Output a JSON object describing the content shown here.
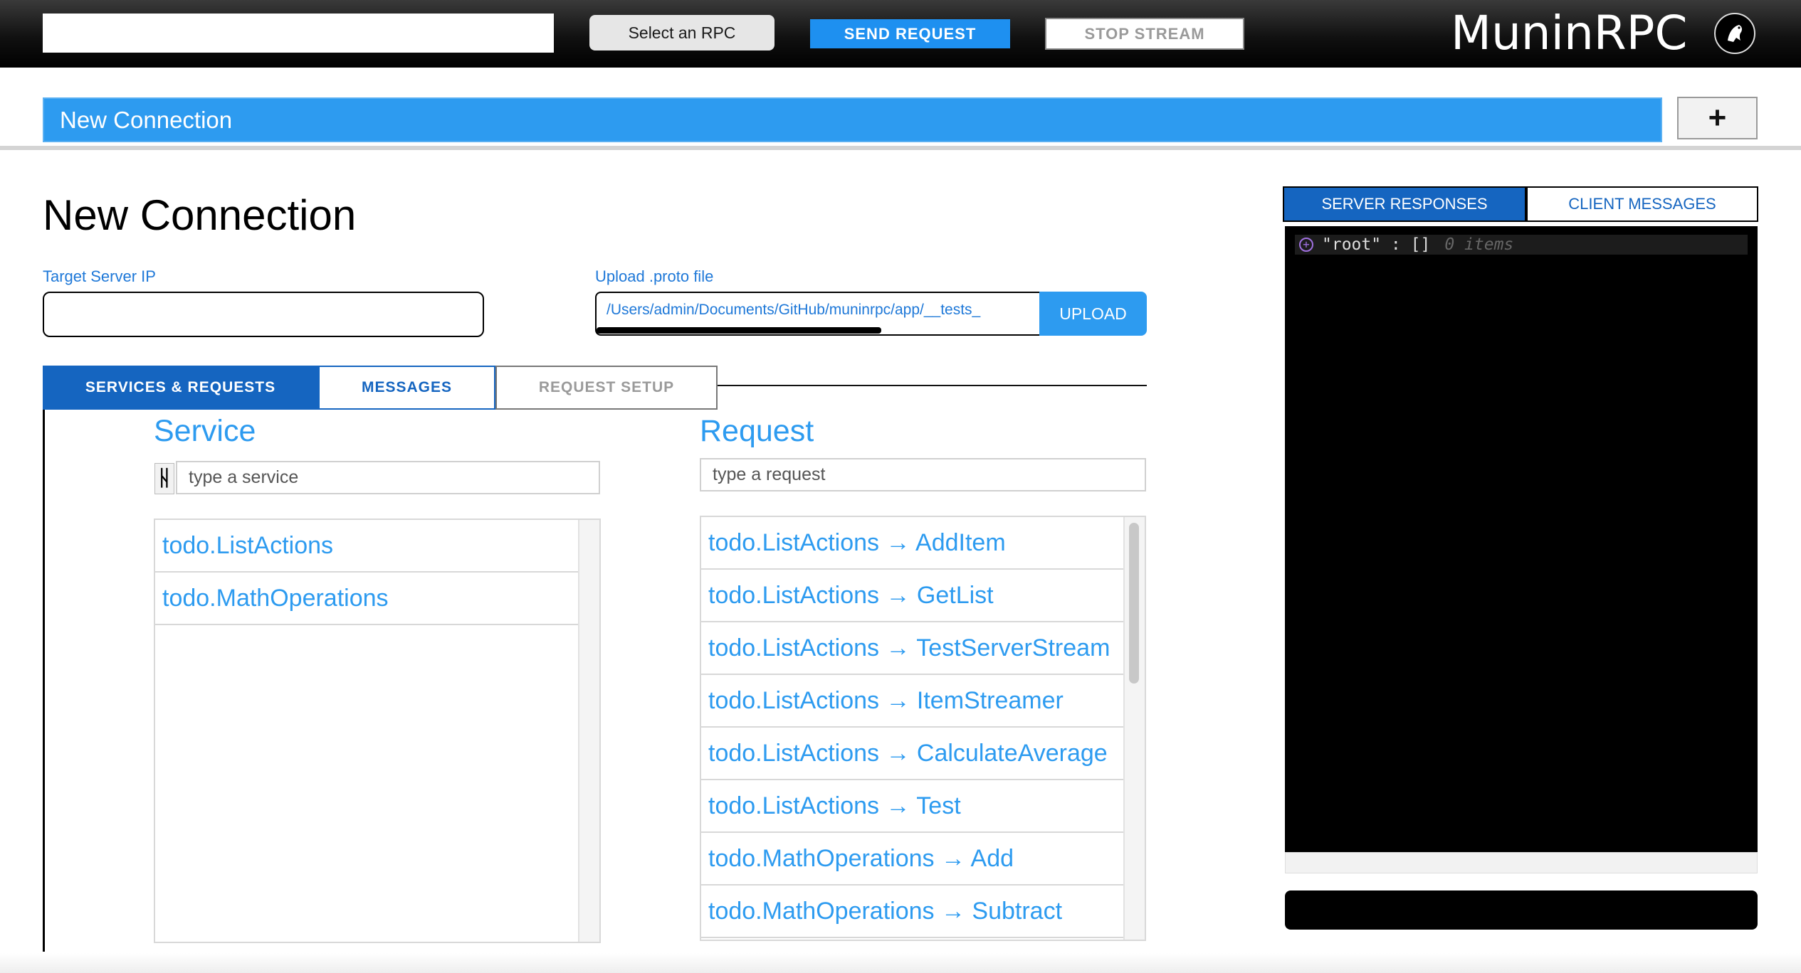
{
  "topbar": {
    "address_value": "",
    "select_rpc_label": "Select an RPC",
    "send_label": "SEND REQUEST",
    "stop_label": "STOP STREAM",
    "brand": "MuninRPC",
    "logo_icon": "raven-logo-icon"
  },
  "connection_tab": {
    "label": "New Connection",
    "add_label": "+"
  },
  "main": {
    "title": "New Connection",
    "target_label": "Target Server IP",
    "target_value": "",
    "upload_label": "Upload .proto file",
    "file_path": "/Users/admin/Documents/GitHub/muninrpc/app/__tests_",
    "upload_button": "UPLOAD"
  },
  "tabs": {
    "services": "SERVICES & REQUESTS",
    "messages": "MESSAGES",
    "setup": "REQUEST SETUP"
  },
  "service": {
    "title": "Service",
    "placeholder": "type a service",
    "filter_glyph": "ᚺ",
    "items": [
      "todo.ListActions",
      "todo.MathOperations"
    ]
  },
  "request": {
    "title": "Request",
    "placeholder": "type a request",
    "items": [
      "todo.ListActions → AddItem",
      "todo.ListActions → GetList",
      "todo.ListActions → TestServerStream",
      "todo.ListActions → ItemStreamer",
      "todo.ListActions → CalculateAverage",
      "todo.ListActions → Test",
      "todo.MathOperations → Add",
      "todo.MathOperations → Subtract"
    ]
  },
  "responses": {
    "server_tab": "SERVER RESPONSES",
    "client_tab": "CLIENT MESSAGES",
    "expand_glyph": "+",
    "root_key": "\"root\" : []",
    "root_count": "0 items"
  },
  "colors": {
    "accent": "#2d9bf0",
    "tab_active": "#1565c0",
    "panel_bg": "#000000"
  }
}
